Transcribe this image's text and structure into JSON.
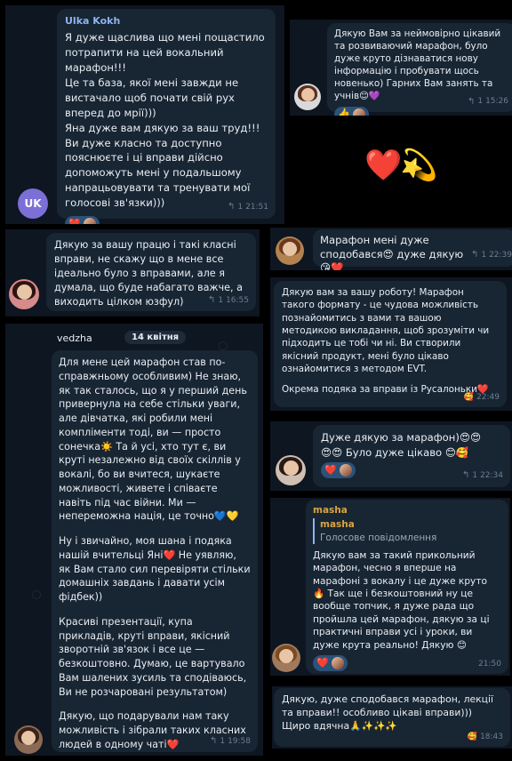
{
  "m1": {
    "author": "Ulka Kokh",
    "avatar_initials": "UK",
    "paragraphs": [
      "Я дуже щаслива що мені пощастило потрапити на цей вокальний марафон!!!",
      "Це та база, якої мені завжди не вистачало щоб почати свій рух вперед до мрії)))",
      "Яна дуже вам дякую за ваш труд!!! Ви дуже класно та доступно пояснюєте і ці вправи дійсно допоможуть мені у подальшому напрацьовувати та тренувати мої голосові зв'язки)))"
    ],
    "reaction": "❤️",
    "replies": "1",
    "time": "21:51"
  },
  "m2": {
    "text": "Дякую Вам за неймовірно цікавий та розвиваючий марафон, було дуже круто дізнаватися нову інформацію і пробувати щось новенько) Гарних Вам занять та учнів😊💜",
    "reaction": "👍",
    "replies": "1",
    "time": "15:26"
  },
  "emoji_sticker": "❤️💫",
  "m3": {
    "text": "Дякую за вашу працю і такі класні вправи, не скажу що в мене все ідеально було з вправами, але я думала, що буде набагато важче, а виходить цілком юзфул)",
    "replies": "1",
    "time": "16:55"
  },
  "m4": {
    "text": "Марафон мені дуже сподобався😍 дуже дякую😘❤️",
    "replies": "1",
    "time": "22:39"
  },
  "m5": {
    "paragraphs": [
      "Дякую вам за вашу роботу! Марафон такого формату - це чудова можливість познайомитись з вами та вашою методикою викладання, щоб зрозуміти чи підходить це тобі чи ні. Ви створили якісний продукт, мені було цікаво ознайомитися з методом EVT.",
      "Окрема подяка за вправи із Русалоньки❤️"
    ],
    "time": "22:49"
  },
  "m6": {
    "author": "vedzha",
    "date": "14 квітня",
    "paragraphs": [
      "Для мене цей марафон став по-справжньому особливим) Не знаю, як так сталось, що я у перший день привернула на себе стільки уваги, але дівчатка, які робили мені компліменти тоді, ви — просто сонечка☀️ Та й усі, хто тут є, ви круті незалежно від своїх скіллів у вокалі, бо ви вчитеся, шукаєте можливості, живете і співаєте навіть під час війни. Ми — непереможна нація, це точно💙💛",
      "Ну і звичайно, моя шана і подяка нашій вчительці Яні❤️ Не уявляю, як Вам стало сил перевіряти стільки домашніх завдань і давати усім фідбек))",
      "Красиві презентації, купа прикладів, круті вправи, якісний зворотній зв'язок і все це — безкоштовно. Думаю, це вартувало Вам шалених зусиль та сподіваюсь, Ви не розчаровані результатом)",
      "Дякую, що подарували нам таку можливість і зібрали таких класних людей в одному чаті❤️"
    ],
    "reactions": [
      "👍",
      "❤️",
      "🥰"
    ],
    "replies": "1",
    "time": "19:58"
  },
  "m7": {
    "text": "Дуже дякую за марафон)😍😍😍😍 Було дуже цікаво 😊🥰",
    "replies": "1",
    "time": "22:34"
  },
  "m8": {
    "author": "masha",
    "quote_name": "masha",
    "quote_text": "Голосове повідомлення",
    "text": "Дякую вам за такий прикольний марафон, чесно я вперше на марафоні з вокалу і це дуже круто 🔥 Так ще і безкоштовний ну це вообще топчик, я дуже рада що пройшла цей марафон, дякую за ці практичні вправи усі і уроки, ви дуже крута реально! Дякую 😊",
    "reaction": "❤️",
    "time": "21:50"
  },
  "m9": {
    "text": "Дякую, дуже сподобався марафон, лекції та вправи!! особливо цікаві вправи))) Щиро вдячна🙏✨✨✨",
    "time": "18:43"
  }
}
